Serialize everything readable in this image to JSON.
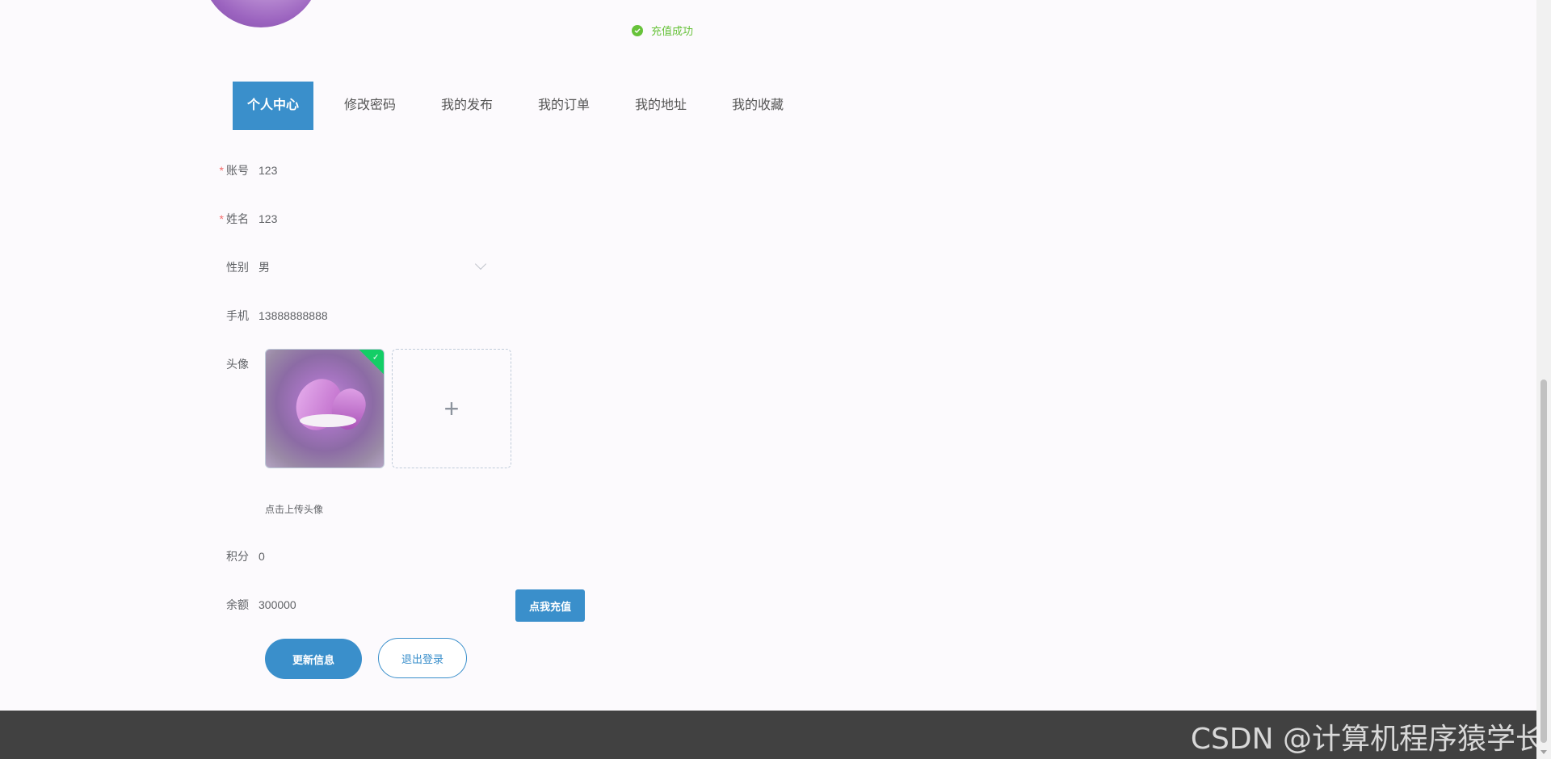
{
  "toast": {
    "message": "充值成功"
  },
  "tabs": [
    {
      "label": "个人中心"
    },
    {
      "label": "修改密码"
    },
    {
      "label": "我的发布"
    },
    {
      "label": "我的订单"
    },
    {
      "label": "我的地址"
    },
    {
      "label": "我的收藏"
    }
  ],
  "form": {
    "account": {
      "label": "账号",
      "value": "123"
    },
    "name": {
      "label": "姓名",
      "value": "123"
    },
    "gender": {
      "label": "性别",
      "value": "男"
    },
    "phone": {
      "label": "手机",
      "value": "13888888888"
    },
    "avatar": {
      "label": "头像",
      "hint": "点击上传头像",
      "add_icon": "+"
    },
    "points": {
      "label": "积分",
      "value": "0"
    },
    "balance": {
      "label": "余额",
      "value": "300000"
    }
  },
  "buttons": {
    "recharge": "点我充值",
    "update": "更新信息",
    "logout": "退出登录"
  },
  "watermark": "CSDN @计算机程序猿学长",
  "colors": {
    "primary": "#3a8fcb",
    "success": "#67c23a",
    "required": "#f56c6c",
    "footer": "#414141"
  }
}
